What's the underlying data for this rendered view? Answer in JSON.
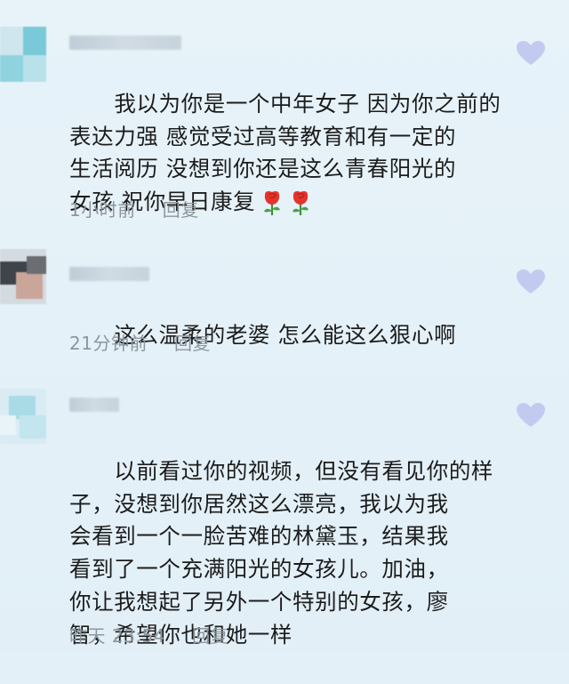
{
  "comments": [
    {
      "username": "",
      "text": "我以为你是一个中年女子 因为你之前的\n表达力强 感觉受过高等教育和有一定的\n生活阅历 没想到你还是这么青春阳光的\n女孩 祝你早日康复",
      "emoji": [
        "rose-emoji",
        "rose-emoji"
      ],
      "time": "1小时前",
      "reply_label": "回复"
    },
    {
      "username": "",
      "text": "这么温柔的老婆 怎么能这么狠心啊",
      "time": "21分钟前",
      "reply_label": "回复"
    },
    {
      "username": "",
      "text": "以前看过你的视频，但没有看见你的样\n子，没想到你居然这么漂亮，我以为我\n会看到一个一脸苦难的林黛玉，结果我\n看到了一个充满阳光的女孩儿。加油，\n你让我想起了另外一个特别的女孩，廖\n智，希望你也和她一样",
      "time": "昨天 23:54",
      "reply_label": "回复"
    }
  ],
  "icons": {
    "like": "heart-icon",
    "emoji": "rose-emoji"
  },
  "colors": {
    "background": "#e4f0f7",
    "text": "#1c1c1c",
    "meta": "#8d969d",
    "heart": "#c2cbef",
    "rose": "#e4332c"
  }
}
